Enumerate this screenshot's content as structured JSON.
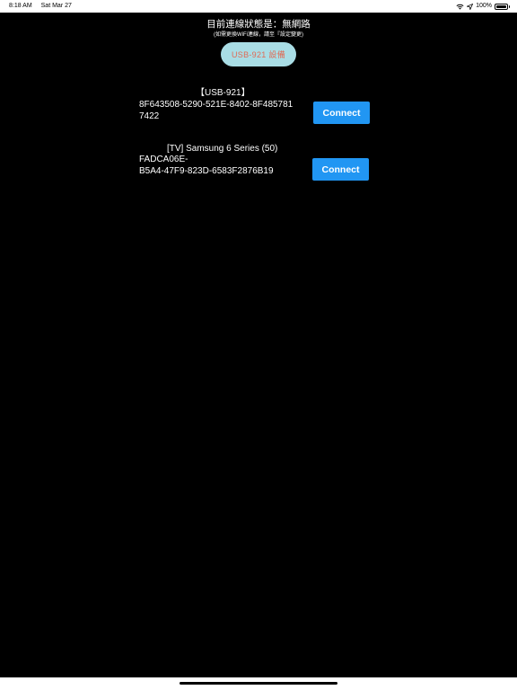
{
  "status_bar": {
    "time": "8:18 AM",
    "date": "Sat Mar 27",
    "battery": "100%"
  },
  "header": {
    "connection_status": "目前連線狀態是：無網路",
    "hint": "(如需更換WiFi連線，請至『設定變更)",
    "device_button": "USB-921 設備"
  },
  "devices": [
    {
      "name": "【USB-921】",
      "id_line1": "8F643508-5290-521E-8402-8F485781",
      "id_line2": "7422",
      "action": "Connect"
    },
    {
      "name": "[TV] Samsung 6 Series (50)",
      "id_line1": "FADCA06E-",
      "id_line2": "B5A4-47F9-823D-6583F2876B19",
      "action": "Connect"
    }
  ],
  "colors": {
    "background": "#000000",
    "pill_bg": "#a9dde5",
    "pill_text": "#e06a55",
    "button": "#2196f3"
  }
}
